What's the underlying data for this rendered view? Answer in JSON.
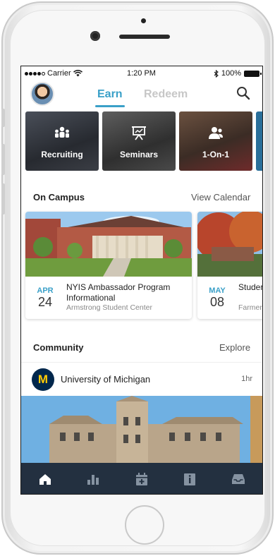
{
  "status_bar": {
    "carrier": "Carrier",
    "time": "1:20 PM",
    "battery": "100%"
  },
  "header": {
    "tabs": [
      {
        "label": "Earn",
        "active": true
      },
      {
        "label": "Redeem",
        "active": false
      }
    ],
    "avatar_icon": "user-avatar",
    "search_icon": "search-icon"
  },
  "categories": [
    {
      "label": "Recruiting",
      "icon": "group-icon"
    },
    {
      "label": "Seminars",
      "icon": "presentation-icon"
    },
    {
      "label": "1-On-1",
      "icon": "one-on-one-icon"
    }
  ],
  "on_campus": {
    "title": "On Campus",
    "link": "View Calendar",
    "events": [
      {
        "month": "APR",
        "day": "24",
        "title": "NYIS Ambassador Program Informational",
        "location": "Armstrong Student Center"
      },
      {
        "month": "MAY",
        "day": "08",
        "title": "Studer and G",
        "location": "Farmer"
      }
    ]
  },
  "community": {
    "title": "Community",
    "link": "Explore",
    "post": {
      "logo_letter": "M",
      "name": "University of Michigan",
      "time": "1hr"
    }
  },
  "tab_bar": [
    {
      "icon": "home-icon",
      "active": true
    },
    {
      "icon": "stats-icon",
      "active": false
    },
    {
      "icon": "calendar-add-icon",
      "active": false
    },
    {
      "icon": "info-document-icon",
      "active": false
    },
    {
      "icon": "inbox-icon",
      "active": false
    }
  ],
  "colors": {
    "accent": "#3aa0c8",
    "tab_bar": "#233040",
    "michigan_blue": "#00274c",
    "michigan_maize": "#ffcb05"
  }
}
